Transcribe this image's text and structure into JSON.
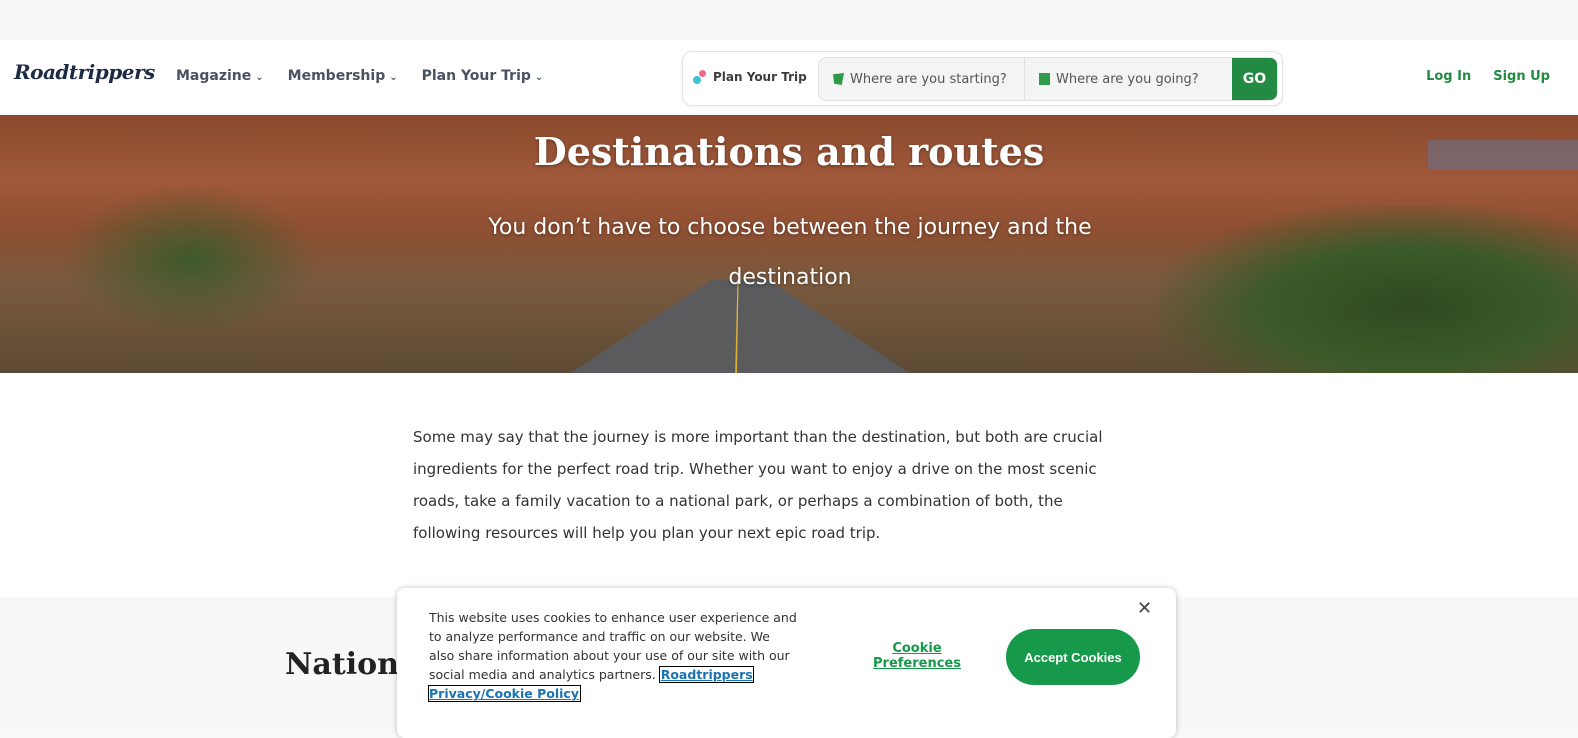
{
  "header": {
    "logo": "Roadtrippers",
    "menu": [
      {
        "label": "Magazine"
      },
      {
        "label": "Membership"
      },
      {
        "label": "Plan Your Trip"
      }
    ],
    "planner": {
      "label": "Plan Your Trip",
      "start_placeholder": "Where are you starting?",
      "dest_placeholder": "Where are you going?",
      "go_label": "GO"
    },
    "login": "Log In",
    "signup": "Sign Up"
  },
  "hero": {
    "title": "Destinations and routes",
    "subtitle": "You don’t have to choose between the journey and the destination"
  },
  "intro": "Some may say that the journey is more important than the destination, but both are crucial ingredients for the perfect road trip. Whether you want to enjoy a drive on the most scenic roads, take a family vacation to a national park, or perhaps a combination of both, the following resources will help you plan your next epic road trip.",
  "section": {
    "heading": "National"
  },
  "cookie": {
    "text": "This website uses cookies to enhance user experience and to analyze performance and traffic on our website. We also share information about your use of our site with our social media and analytics partners.",
    "policy_link": "Roadtrippers Privacy/Cookie Policy",
    "preferences": "Cookie Preferences",
    "accept": "Accept Cookies",
    "close": "✕"
  },
  "colors": {
    "brand_green": "#238a43",
    "cookie_green": "#16994a",
    "link_blue": "#1a73b5"
  }
}
